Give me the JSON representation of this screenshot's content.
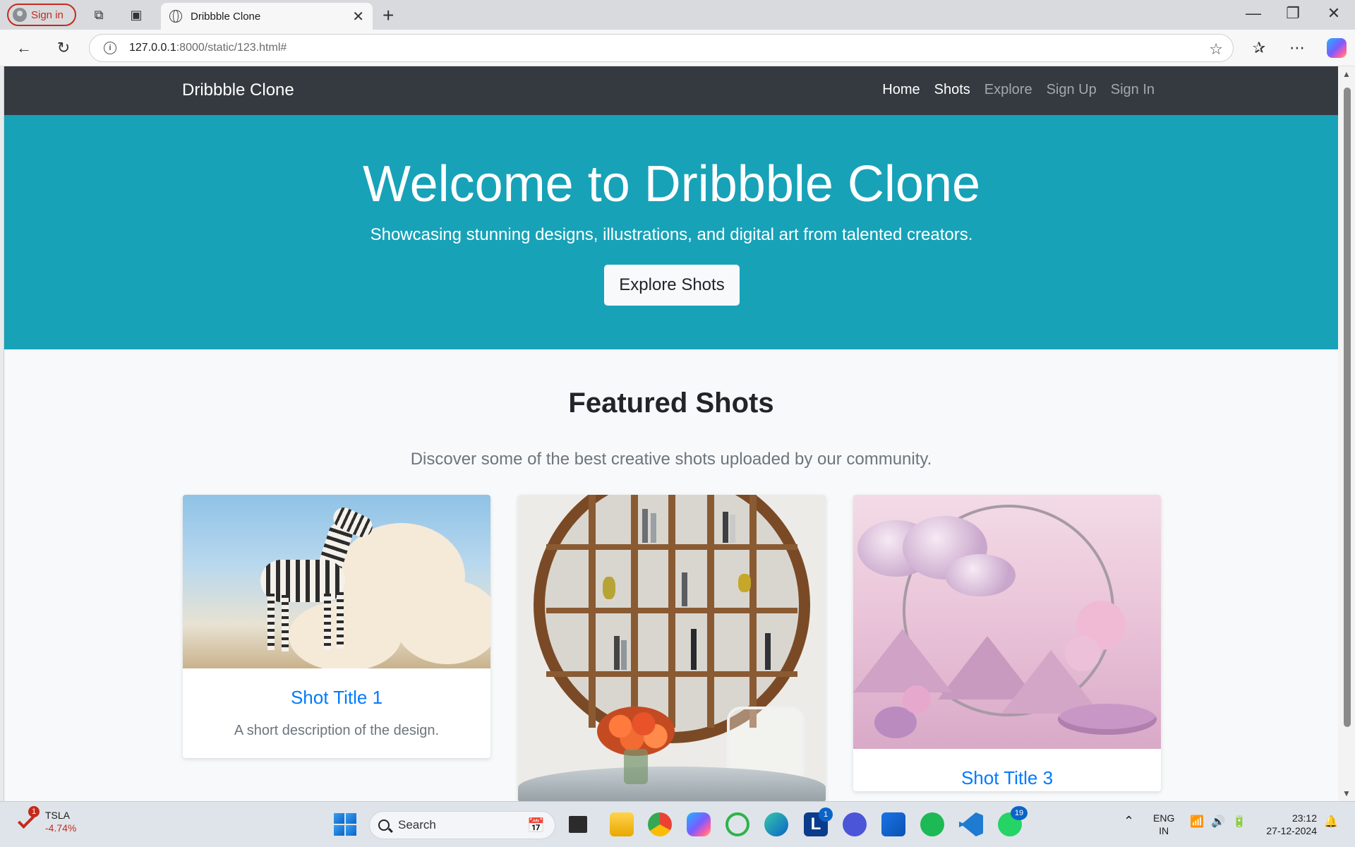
{
  "browser": {
    "signin_label": "Sign in",
    "tab_title": "Dribbble Clone",
    "url_host": "127.0.0.1",
    "url_path": ":8000/static/123.html#"
  },
  "site": {
    "brand": "Dribbble Clone",
    "nav": [
      "Home",
      "Shots",
      "Explore",
      "Sign Up",
      "Sign In"
    ]
  },
  "hero": {
    "title": "Welcome to Dribbble Clone",
    "subtitle": "Showcasing stunning designs, illustrations, and digital art from talented creators.",
    "button": "Explore Shots"
  },
  "featured": {
    "title": "Featured Shots",
    "subtitle": "Discover some of the best creative shots uploaded by our community.",
    "cards": [
      {
        "title": "Shot Title 1",
        "description": "A short description of the design."
      },
      {
        "title": "",
        "description": ""
      },
      {
        "title": "Shot Title 3",
        "description": ""
      }
    ]
  },
  "taskbar": {
    "stock_symbol": "TSLA",
    "stock_change": "-4.74%",
    "stock_badge": "1",
    "search_placeholder": "Search",
    "lang_line1": "ENG",
    "lang_line2": "IN",
    "time": "23:12",
    "date": "27-12-2024",
    "l_badge": "1",
    "whatsapp_badge": "19"
  }
}
